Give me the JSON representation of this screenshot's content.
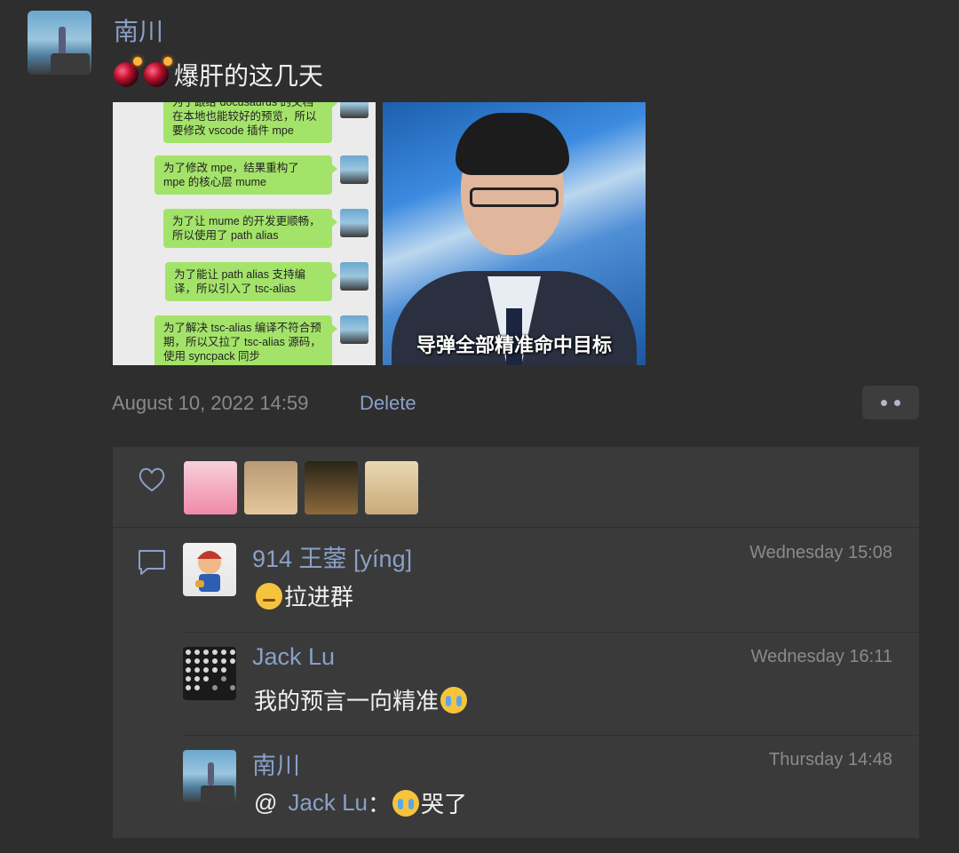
{
  "post": {
    "author": "南川",
    "text": "爆肝的这几天",
    "timestamp": "August 10, 2022 14:59",
    "delete_label": "Delete",
    "chat_image": {
      "messages": [
        "为了跟给 docusaurus 的文档在本地也能较好的预览，所以要修改 vscode 插件 mpe",
        "为了修改 mpe，结果重构了 mpe 的核心层 mume",
        "为了让 mume 的开发更顺畅，所以使用了 path alias",
        "为了能让 path alias 支持编译，所以引入了 tsc-alias",
        "为了解决 tsc-alias 编译不符合预期，所以又拉了 tsc-alias 源码，使用 syncpack 同步"
      ]
    },
    "news_image": {
      "caption": "导弹全部精准命中目标"
    }
  },
  "comments": [
    {
      "name": "914 王蓥 [yíng]",
      "time": "Wednesday 15:08",
      "text": "拉进群"
    },
    {
      "name": "Jack Lu",
      "time": "Wednesday 16:11",
      "text": "我的预言一向精准"
    },
    {
      "name": "南川",
      "time": "Thursday 14:48",
      "prefix": "@",
      "mention": "Jack Lu",
      "suffix": "：",
      "text": "哭了"
    }
  ],
  "colors": {
    "background": "#2e2e2e",
    "panel": "#3a3a3a",
    "link": "#8aa0c8",
    "muted": "#8a8a8a"
  }
}
